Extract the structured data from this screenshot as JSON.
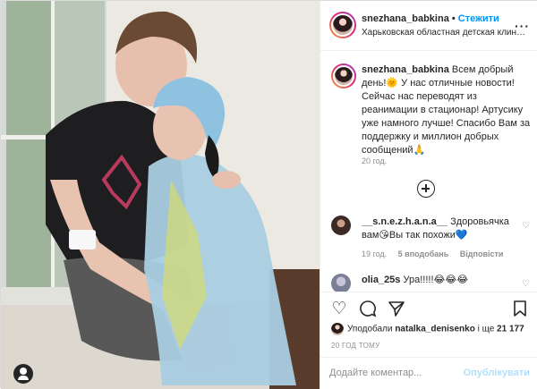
{
  "header": {
    "username": "snezhana_babkina",
    "separator": " • ",
    "follow": "Стежити",
    "location": "Харьковская областная детская клиническа...",
    "more": "···"
  },
  "caption": {
    "username": "snezhana_babkina",
    "text": "Всем добрый день!🌞 У нас отличные новости! Сейчас нас переводят из реанимации в стационар! Артусику уже намного лучше! Спасибо Вам за поддержку и миллион добрых сообщений🙏",
    "time": "20 год."
  },
  "comments": [
    {
      "username": "__s.n.e.z.h.a.n.a__",
      "text": "Здоровьячка вам😘Вы так похожи💙",
      "time": "19 год.",
      "likes": "5 вподобань",
      "reply": "Відповісти"
    },
    {
      "username": "olia_25s",
      "text": "Ура!!!!!😂😂😂",
      "time": "",
      "likes": "",
      "reply": ""
    }
  ],
  "likes": {
    "prefix": "Уподобали ",
    "user": "natalka_denisenko",
    "middle": " і ще ",
    "count": "21 177"
  },
  "post_time": "20 ГОД ТОМУ",
  "add_comment": {
    "placeholder": "Додайте коментар...",
    "post": "Опублікувати"
  },
  "icons": {
    "like": "heart-icon",
    "comment": "comment-icon",
    "share": "share-icon",
    "save": "bookmark-icon"
  },
  "colors": {
    "accent": "#0095f6",
    "muted": "#8e8e8e",
    "border": "#dbdbdb"
  }
}
